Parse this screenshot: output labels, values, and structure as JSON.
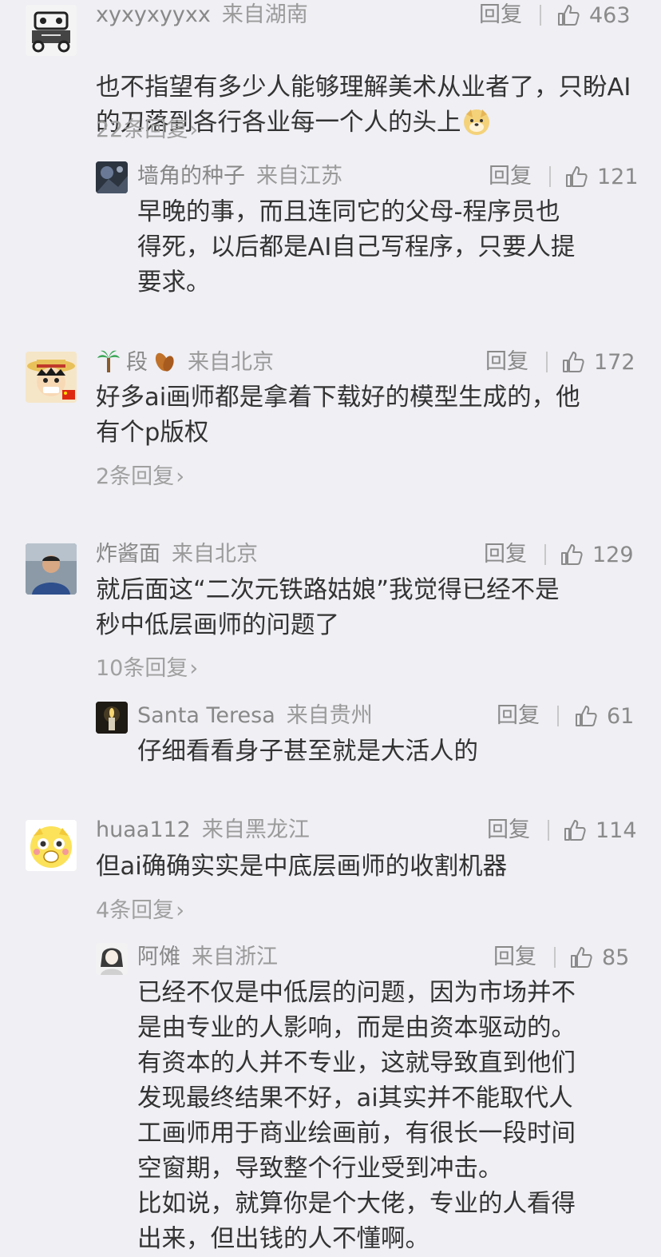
{
  "comments": [
    {
      "username": "xyxyxyyxx",
      "location": "来自湖南",
      "reply_label": "回复",
      "likes": "463",
      "text": "也不指望有多少人能够理解美术从业者了，只盼AI的刀落到各行各业每一个人的头上",
      "trailing_emoji": "doge-emoji",
      "sub_replies_count": "22条回复",
      "avatar_icon": "robot-sketch-avatar"
    },
    {
      "username": "墙角的种子",
      "location": "来自江苏",
      "reply_label": "回复",
      "likes": "121",
      "text": "早晚的事，而且连同它的父母-程序员也\n得死，以后都是AI自己写程序，只要人提\n要求。",
      "avatar_icon": "dark-photo-avatar"
    },
    {
      "username": "段",
      "username_prefix_icon": "palm-tree-emoji",
      "username_suffix_icon": "fallen-leaf-emoji",
      "location": "来自北京",
      "reply_label": "回复",
      "likes": "172",
      "text": "好多ai画师都是拿着下载好的模型生成的，他\n有个p版权",
      "sub_replies_count": "2条回复",
      "avatar_icon": "anime-straw-hat-avatar"
    },
    {
      "username": "炸酱面",
      "location": "来自北京",
      "reply_label": "回复",
      "likes": "129",
      "text": "就后面这“二次元铁路姑娘”我觉得已经不是\n秒中低层画师的问题了",
      "sub_replies_count": "10条回复",
      "avatar_icon": "person-photo-avatar"
    },
    {
      "username": "Santa Teresa",
      "location": "来自贵州",
      "reply_label": "回复",
      "likes": "61",
      "text": "仔细看看身子甚至就是大活人的",
      "avatar_icon": "candle-photo-avatar"
    },
    {
      "username": "huaa112",
      "location": "来自黑龙江",
      "reply_label": "回复",
      "likes": "114",
      "text": "但ai确确实实是中底层画师的收割机器",
      "sub_replies_count": "4条回复",
      "avatar_icon": "yellow-emoji-face-avatar"
    },
    {
      "username": "阿傩",
      "location": "来自浙江",
      "reply_label": "回复",
      "likes": "85",
      "text": "已经不仅是中低层的问题，因为市场并不\n是由专业的人影响，而是由资本驱动的。\n有资本的人并不专业，这就导致直到他们\n发现最终结果不好，ai其实并不能取代人\n工画师用于商业绘画前，有很长一段时间\n空窗期，导致整个行业受到冲击。\n比如说，就算你是个大佬，专业的人看得\n出来，但出钱的人不懂啊。",
      "avatar_icon": "sketch-girl-avatar"
    }
  ],
  "icons": {
    "like": "thumbs-up-icon",
    "chevron": "chevron-right-icon"
  },
  "colors": {
    "background": "#efeff4",
    "text_primary": "#333333",
    "text_secondary": "#8a8a8a"
  }
}
